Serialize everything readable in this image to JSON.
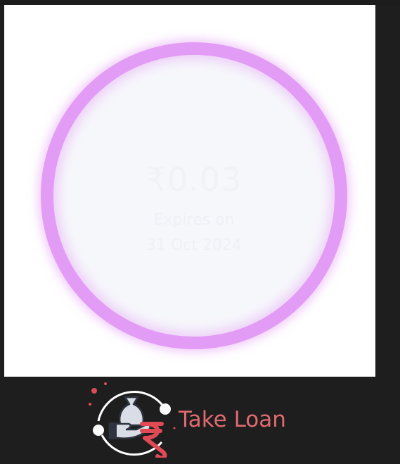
{
  "wallet": {
    "balance": "₹0.03",
    "expires_label": "Expires on",
    "expires_date": "31 Oct 2024"
  },
  "loan": {
    "label": "Take Loan",
    "icon": "loan-money-bag-hand-rupee-icon"
  },
  "colors": {
    "ring": "#e39cf5",
    "ring_fill": "#f6f7fb",
    "accent": "#e16a70",
    "background": "#1e1e1e"
  }
}
